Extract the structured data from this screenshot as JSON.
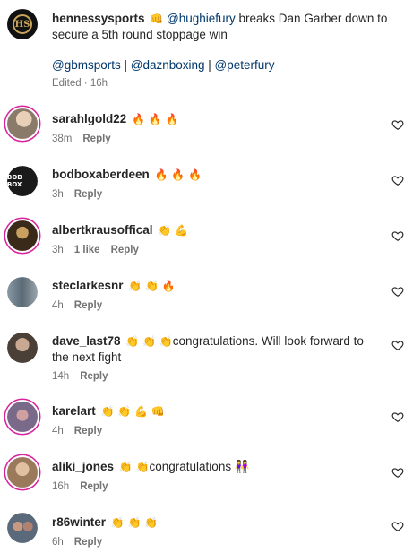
{
  "post": {
    "username": "hennessysports",
    "emoji": "👊",
    "mention": "@hughiefury",
    "caption": " breaks Dan Garber down to secure a 5th round stoppage win",
    "tags": [
      "@gbmsports",
      "@daznboxing",
      "@peterfury"
    ],
    "tag_separator": " | ",
    "meta": "Edited · 16h",
    "avatar_icon": "hennessy-logo-icon",
    "avatar_letters": "HS"
  },
  "comments": [
    {
      "username": "sarahlgold22",
      "emojis": "🔥 🔥 🔥",
      "text": "",
      "time": "38m",
      "likes": "",
      "reply": "Reply",
      "avatar_color": "#8a7a6a"
    },
    {
      "username": "bodboxaberdeen",
      "emojis": "🔥 🔥 🔥",
      "text": "",
      "time": "3h",
      "likes": "",
      "reply": "Reply",
      "avatar_color": "#1a1a1a"
    },
    {
      "username": "albertkrausoffical",
      "emojis": "👏 💪",
      "text": "",
      "time": "3h",
      "likes": "1 like",
      "reply": "Reply",
      "avatar_color": "#3a2a1a"
    },
    {
      "username": "steclarkesnr",
      "emojis": "👏 👏 🔥",
      "text": "",
      "time": "4h",
      "likes": "",
      "reply": "Reply",
      "avatar_color": "#6f7d86"
    },
    {
      "username": "dave_last78",
      "emojis": "👏 👏 👏",
      "text": "congratulations. Will look forward to the next fight",
      "time": "14h",
      "likes": "",
      "reply": "Reply",
      "avatar_color": "#4a4038"
    },
    {
      "username": "karelart",
      "emojis": "👏 👏 💪 👊",
      "text": "",
      "time": "4h",
      "likes": "",
      "reply": "Reply",
      "avatar_color": "#7a6a8a"
    },
    {
      "username": "aliki_jones",
      "emojis": "👏 👏",
      "text": "congratulations 👭",
      "time": "16h",
      "likes": "",
      "reply": "Reply",
      "avatar_color": "#9a7a5a"
    },
    {
      "username": "r86winter",
      "emojis": "👏 👏 👏",
      "text": "",
      "time": "6h",
      "likes": "",
      "reply": "Reply",
      "avatar_color": "#5a6a7a"
    }
  ],
  "colors": {
    "mention": "#00376b",
    "secondary_text": "#737373",
    "story_ring": "#d6249f"
  },
  "icons": {
    "like": "heart-outline-icon"
  }
}
